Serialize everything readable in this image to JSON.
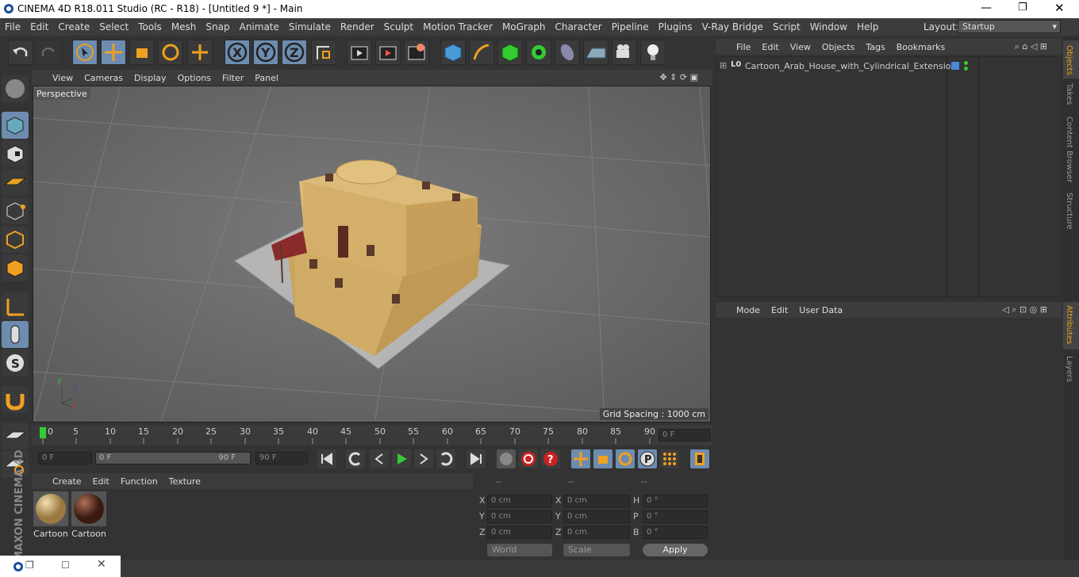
{
  "window": {
    "title": "CINEMA 4D R18.011 Studio (RC - R18) - [Untitled 9 *] - Main"
  },
  "menu": [
    "File",
    "Edit",
    "Create",
    "Select",
    "Tools",
    "Mesh",
    "Snap",
    "Animate",
    "Simulate",
    "Render",
    "Sculpt",
    "Motion Tracker",
    "MoGraph",
    "Character",
    "Pipeline",
    "Plugins",
    "V-Ray Bridge",
    "Script",
    "Window",
    "Help"
  ],
  "layout": {
    "label": "Layout:",
    "value": "Startup"
  },
  "viewport": {
    "menu": [
      "View",
      "Cameras",
      "Display",
      "Options",
      "Filter",
      "Panel"
    ],
    "label": "Perspective",
    "grid": "Grid Spacing : 1000 cm"
  },
  "objects": {
    "menu": [
      "File",
      "Edit",
      "View",
      "Objects",
      "Tags",
      "Bookmarks"
    ],
    "item": "Cartoon_Arab_House_with_Cylindrical_Extension",
    "layer_badge": "L0"
  },
  "attributes": {
    "menu": [
      "Mode",
      "Edit",
      "User Data"
    ]
  },
  "sidetabs_top": [
    "Objects",
    "Takes",
    "Content Browser",
    "Structure"
  ],
  "sidetabs_bottom": [
    "Attributes",
    "Layers"
  ],
  "timeline": {
    "ticks": [
      "0",
      "5",
      "10",
      "15",
      "20",
      "25",
      "30",
      "35",
      "40",
      "45",
      "50",
      "55",
      "60",
      "65",
      "70",
      "75",
      "80",
      "85",
      "90"
    ],
    "current": "0 F",
    "start": "0 F",
    "range_start": "0 F",
    "range_end": "90 F",
    "end": "90 F"
  },
  "materials": {
    "menu": [
      "Create",
      "Edit",
      "Function",
      "Texture"
    ],
    "items": [
      "Cartoon",
      "Cartoon"
    ]
  },
  "coords": {
    "headers": [
      "--",
      "--",
      "--"
    ],
    "rows": [
      {
        "a": "X",
        "av": "0 cm",
        "b": "X",
        "bv": "0 cm",
        "c": "H",
        "cv": "0 °"
      },
      {
        "a": "Y",
        "av": "0 cm",
        "b": "Y",
        "bv": "0 cm",
        "c": "P",
        "cv": "0 °"
      },
      {
        "a": "Z",
        "av": "0 cm",
        "b": "Z",
        "bv": "0 cm",
        "c": "B",
        "cv": "0 °"
      }
    ],
    "world": "World",
    "scale": "Scale",
    "apply": "Apply"
  },
  "brand": "MAXON CINEMA 4D"
}
